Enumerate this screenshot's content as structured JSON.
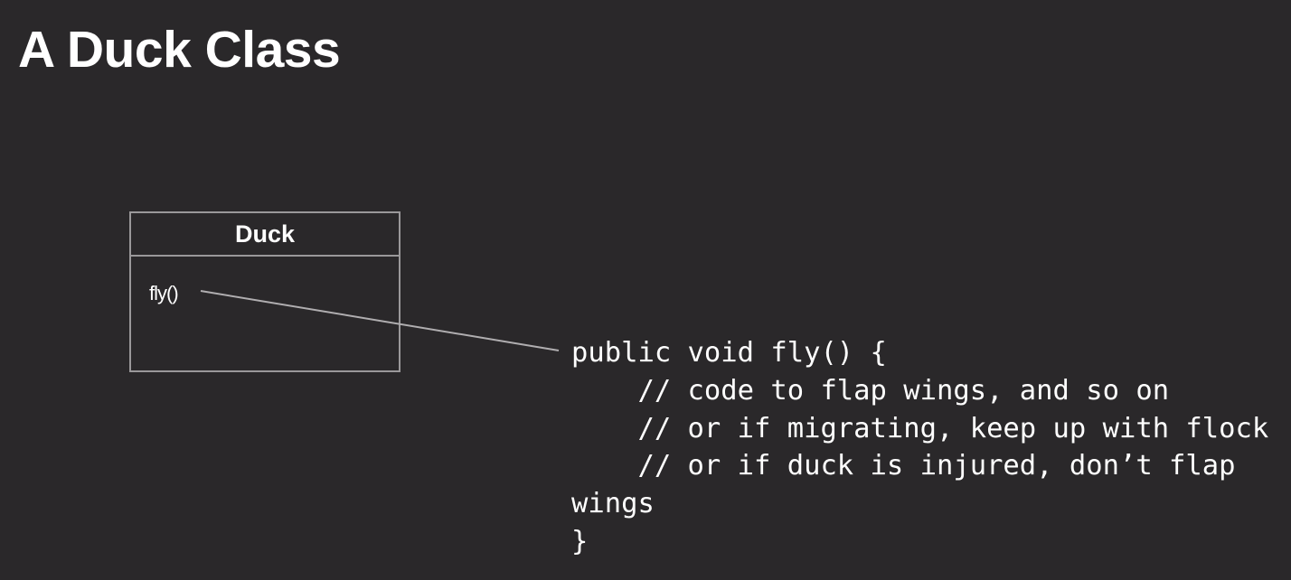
{
  "slide": {
    "title": "A Duck Class"
  },
  "uml_class": {
    "name": "Duck",
    "methods": [
      "fly()"
    ]
  },
  "code": {
    "lines": [
      "public void fly() {",
      "    // code to flap wings, and so on",
      "    // or if migrating, keep up with flock",
      "    // or if duck is injured, don’t flap",
      "wings",
      "}"
    ]
  }
}
